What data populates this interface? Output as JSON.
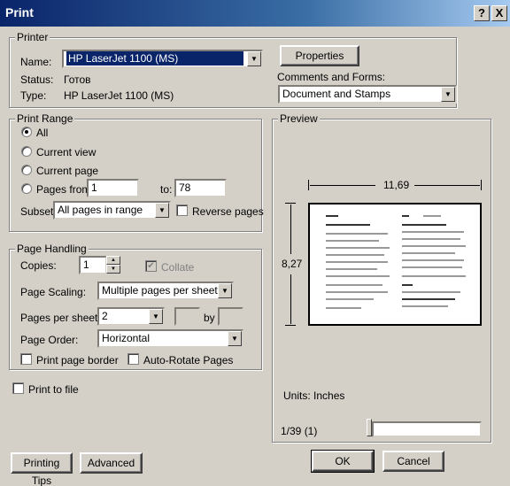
{
  "window": {
    "title": "Print",
    "help_label": "?",
    "close_label": "X"
  },
  "printer": {
    "group_label": "Printer",
    "name_label": "Name:",
    "name_value": "HP LaserJet 1100 (MS)",
    "status_label": "Status:",
    "status_value": "Готов",
    "type_label": "Type:",
    "type_value": "HP LaserJet 1100 (MS)",
    "properties_label": "Properties",
    "comments_label": "Comments and Forms:",
    "comments_value": "Document and Stamps"
  },
  "print_range": {
    "group_label": "Print Range",
    "all_label": "All",
    "current_view_label": "Current view",
    "current_page_label": "Current page",
    "pages_from_label": "Pages from:",
    "pages_from_value": "1",
    "to_label": "to:",
    "to_value": "78",
    "subset_label": "Subset:",
    "subset_value": "All pages in range",
    "reverse_label": "Reverse pages"
  },
  "page_handling": {
    "group_label": "Page Handling",
    "copies_label": "Copies:",
    "copies_value": "1",
    "collate_label": "Collate",
    "scaling_label": "Page Scaling:",
    "scaling_value": "Multiple pages per sheet",
    "pps_label": "Pages per sheet:",
    "pps_value": "2",
    "by_label": "by",
    "order_label": "Page Order:",
    "order_value": "Horizontal",
    "border_label": "Print page border",
    "autorotate_label": "Auto-Rotate Pages"
  },
  "print_to_file_label": "Print to file",
  "preview": {
    "group_label": "Preview",
    "width_value": "11,69",
    "height_value": "8,27",
    "units_text": "Units: Inches",
    "page_indicator": "1/39 (1)"
  },
  "buttons": {
    "tips_label": "Printing Tips",
    "advanced_label": "Advanced",
    "ok_label": "OK",
    "cancel_label": "Cancel"
  }
}
